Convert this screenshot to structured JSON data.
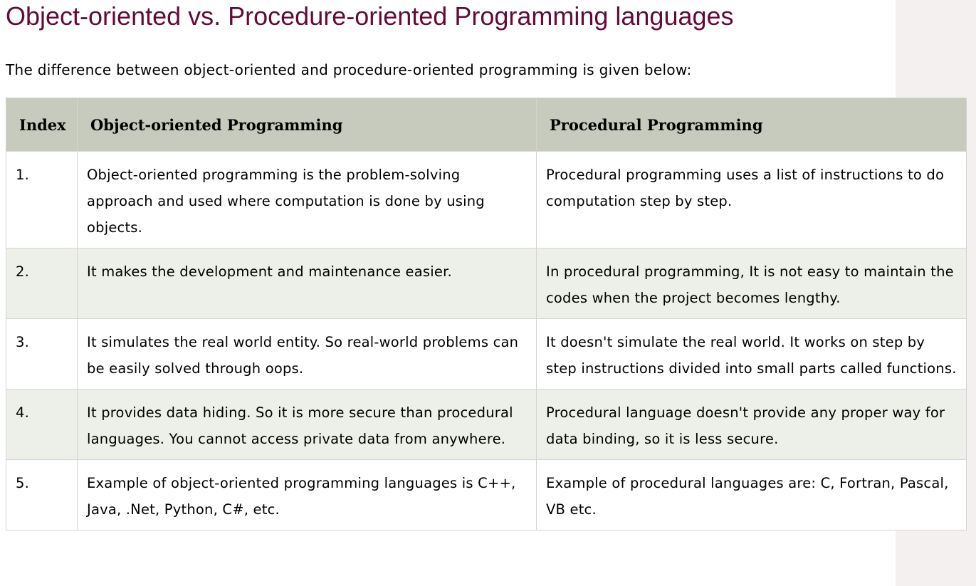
{
  "heading": "Object-oriented vs. Procedure-oriented Programming languages",
  "intro": "The difference between object-oriented and procedure-oriented programming is given below:",
  "table": {
    "headers": [
      "Index",
      "Object-oriented Programming",
      "Procedural Programming"
    ],
    "rows": [
      {
        "index": "1.",
        "oop": "Object-oriented programming is the problem-solving approach and used where computation is done by using objects.",
        "pop": "Procedural programming uses a list of instructions to do computation step by step."
      },
      {
        "index": "2.",
        "oop": "It makes the development and maintenance easier.",
        "pop": "In procedural programming, It is not easy to maintain the codes when the project becomes lengthy."
      },
      {
        "index": "3.",
        "oop": "It simulates the real world entity. So real-world problems can be easily solved through oops.",
        "pop": "It doesn't simulate the real world. It works on step by step instructions divided into small parts called functions."
      },
      {
        "index": "4.",
        "oop": "It provides data hiding. So it is more secure than procedural languages. You cannot access private data from anywhere.",
        "pop": "Procedural language doesn't provide any proper way for data binding, so it is less secure."
      },
      {
        "index": "5.",
        "oop": "Example of object-oriented programming languages is C++, Java, .Net, Python, C#, etc.",
        "pop": "Example of procedural languages are: C, Fortran, Pascal, VB etc."
      }
    ]
  },
  "colors": {
    "heading": "#610b38",
    "header_bg": "#c7cbbd",
    "row_alt_bg": "#edf0e9",
    "gutter_bg": "#f5f0f0"
  }
}
